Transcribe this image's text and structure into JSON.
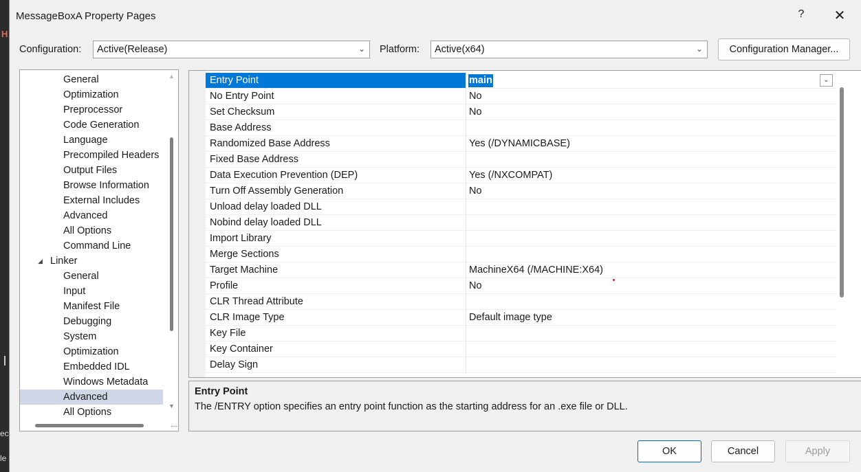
{
  "background": {
    "h_fragment": "H",
    "text1": "ec",
    "text2": "le"
  },
  "window": {
    "title": "MessageBoxA Property Pages",
    "help_label": "?",
    "close_label": "✕"
  },
  "config": {
    "configuration_label": "Configuration:",
    "configuration_value": "Active(Release)",
    "platform_label": "Platform:",
    "platform_value": "Active(x64)",
    "manager_button": "Configuration Manager..."
  },
  "tree": {
    "items": [
      {
        "label": "General"
      },
      {
        "label": "Optimization"
      },
      {
        "label": "Preprocessor"
      },
      {
        "label": "Code Generation"
      },
      {
        "label": "Language"
      },
      {
        "label": "Precompiled Headers"
      },
      {
        "label": "Output Files"
      },
      {
        "label": "Browse Information"
      },
      {
        "label": "External Includes"
      },
      {
        "label": "Advanced"
      },
      {
        "label": "All Options"
      },
      {
        "label": "Command Line"
      },
      {
        "label": "Linker"
      },
      {
        "label": "General"
      },
      {
        "label": "Input"
      },
      {
        "label": "Manifest File"
      },
      {
        "label": "Debugging"
      },
      {
        "label": "System"
      },
      {
        "label": "Optimization"
      },
      {
        "label": "Embedded IDL"
      },
      {
        "label": "Windows Metadata"
      },
      {
        "label": "Advanced"
      },
      {
        "label": "All Options"
      }
    ],
    "expand_glyph": "◢",
    "selected_item": "Advanced"
  },
  "properties": {
    "rows": [
      {
        "name": "Entry Point",
        "value": "main"
      },
      {
        "name": "No Entry Point",
        "value": "No"
      },
      {
        "name": "Set Checksum",
        "value": "No"
      },
      {
        "name": "Base Address",
        "value": ""
      },
      {
        "name": "Randomized Base Address",
        "value": "Yes (/DYNAMICBASE)"
      },
      {
        "name": "Fixed Base Address",
        "value": ""
      },
      {
        "name": "Data Execution Prevention (DEP)",
        "value": "Yes (/NXCOMPAT)"
      },
      {
        "name": "Turn Off Assembly Generation",
        "value": "No"
      },
      {
        "name": "Unload delay loaded DLL",
        "value": ""
      },
      {
        "name": "Nobind delay loaded DLL",
        "value": ""
      },
      {
        "name": "Import Library",
        "value": ""
      },
      {
        "name": "Merge Sections",
        "value": ""
      },
      {
        "name": "Target Machine",
        "value": "MachineX64 (/MACHINE:X64)"
      },
      {
        "name": "Profile",
        "value": "No"
      },
      {
        "name": "CLR Thread Attribute",
        "value": ""
      },
      {
        "name": "CLR Image Type",
        "value": "Default image type"
      },
      {
        "name": "Key File",
        "value": ""
      },
      {
        "name": "Key Container",
        "value": ""
      },
      {
        "name": "Delay Sign",
        "value": ""
      }
    ],
    "selected_row": "Entry Point"
  },
  "description": {
    "title": "Entry Point",
    "text": "The /ENTRY option specifies an entry point function as the starting address for an .exe file or DLL."
  },
  "buttons": {
    "ok": "OK",
    "cancel": "Cancel",
    "apply": "Apply"
  },
  "icons": {
    "dropdown": "chevron-down-icon",
    "scroll_up": "triangle-up-icon",
    "scroll_down": "triangle-down-icon"
  },
  "colors": {
    "selection": "#0078d7",
    "tree_selection": "#cfd7e6",
    "primary_border": "#0067c0"
  }
}
